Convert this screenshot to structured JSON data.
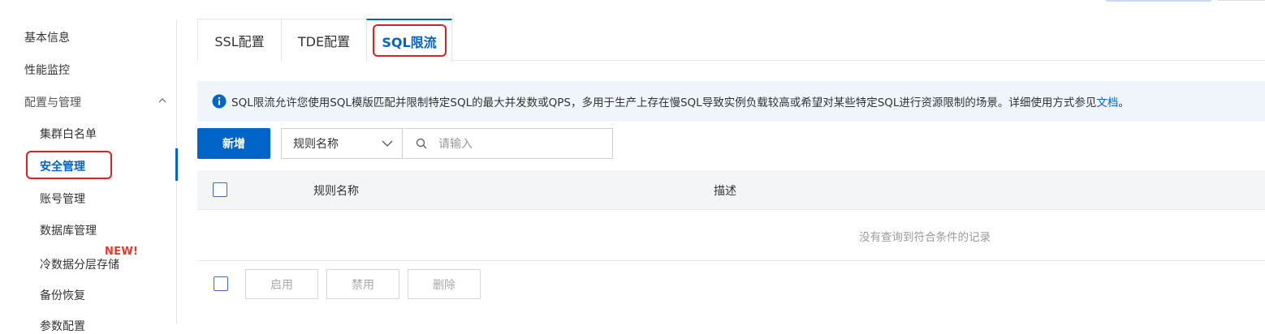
{
  "sidebar": {
    "items": [
      {
        "label": "基本信息"
      },
      {
        "label": "性能监控"
      },
      {
        "label": "配置与管理"
      },
      {
        "label": "集群白名单"
      },
      {
        "label": "安全管理"
      },
      {
        "label": "账号管理"
      },
      {
        "label": "数据库管理"
      },
      {
        "label": "冷数据分层存储",
        "badge": "NEW!"
      },
      {
        "label": "备份恢复"
      },
      {
        "label": "参数配置"
      }
    ],
    "active_item": "安全管理"
  },
  "tabs": [
    {
      "label": "SSL配置"
    },
    {
      "label": "TDE配置"
    },
    {
      "label": "SQL限流"
    }
  ],
  "active_tab": "SQL限流",
  "notice": {
    "icon": "info-icon",
    "text": "SQL限流允许您使用SQL模版匹配并限制特定SQL的最大并发数或QPS，多用于生产上存在慢SQL导致实例负载较高或希望对某些特定SQL进行资源限制的场景。详细使用方式参见",
    "link_text": "文档",
    "suffix": "。"
  },
  "toolbar": {
    "add_label": "新增",
    "filter_select_value": "规则名称",
    "search_placeholder": "请输入"
  },
  "table": {
    "columns": [
      "规则名称",
      "描述"
    ],
    "empty_text": "没有查询到符合条件的记录"
  },
  "batch_actions": {
    "enable_label": "启用",
    "disable_label": "禁用",
    "delete_label": "删除"
  },
  "colors": {
    "accent": "#0064c8",
    "highlight": "#e02020",
    "notice_bg": "#f0f5fc",
    "badge": "#e8362b"
  }
}
